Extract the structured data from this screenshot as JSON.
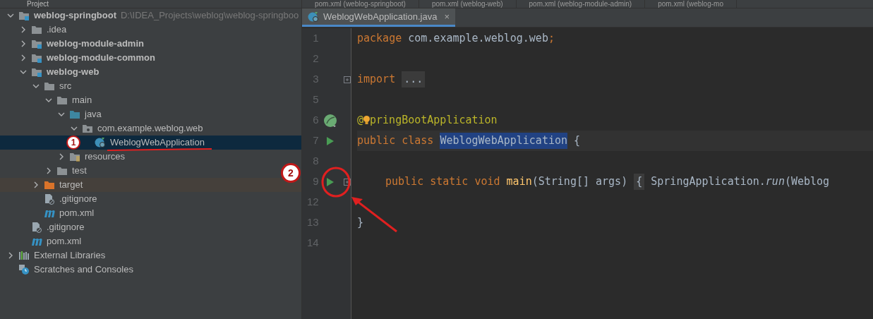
{
  "project_panel": {
    "title": "Project",
    "tree": [
      {
        "label": "weblog-springboot",
        "path": "D:\\IDEA_Projects\\weblog\\weblog-springboo",
        "kind": "module",
        "expanded": true,
        "selected": false,
        "children": [
          {
            "label": ".idea",
            "kind": "folder",
            "expanded": false,
            "selected": false
          },
          {
            "label": "weblog-module-admin",
            "kind": "module",
            "expanded": false,
            "selected": false
          },
          {
            "label": "weblog-module-common",
            "kind": "module",
            "expanded": false,
            "selected": false
          },
          {
            "label": "weblog-web",
            "kind": "module",
            "expanded": true,
            "selected": false,
            "children": [
              {
                "label": "src",
                "kind": "folder",
                "expanded": true,
                "selected": false,
                "children": [
                  {
                    "label": "main",
                    "kind": "folder",
                    "expanded": true,
                    "selected": false,
                    "children": [
                      {
                        "label": "java",
                        "kind": "source",
                        "expanded": true,
                        "selected": false,
                        "children": [
                          {
                            "label": "com.example.weblog.web",
                            "kind": "package",
                            "expanded": true,
                            "selected": false,
                            "children": [
                              {
                                "label": "WeblogWebApplication",
                                "kind": "class",
                                "selected": true
                              }
                            ]
                          }
                        ]
                      },
                      {
                        "label": "resources",
                        "kind": "resources",
                        "expanded": false,
                        "selected": false
                      }
                    ]
                  },
                  {
                    "label": "test",
                    "kind": "folder",
                    "expanded": false,
                    "selected": false
                  }
                ]
              },
              {
                "label": "target",
                "kind": "excluded",
                "expanded": false,
                "selected": false
              },
              {
                "label": ".gitignore",
                "kind": "ignore",
                "selected": false
              },
              {
                "label": "pom.xml",
                "kind": "maven",
                "selected": false
              }
            ]
          },
          {
            "label": ".gitignore",
            "kind": "ignore",
            "selected": false
          },
          {
            "label": "pom.xml",
            "kind": "maven",
            "selected": false
          }
        ]
      },
      {
        "label": "External Libraries",
        "kind": "libraries",
        "expanded": false,
        "selected": false
      },
      {
        "label": "Scratches and Consoles",
        "kind": "scratches",
        "selected": false
      }
    ]
  },
  "editor": {
    "upper_tabs": [
      "pom.xml (weblog-springboot)",
      "pom.xml (weblog-web)",
      "pom.xml (weblog-module-admin)",
      "pom.xml (weblog-mo"
    ],
    "tabs": [
      {
        "label": "WeblogWebApplication.java",
        "close": "×",
        "selected": true
      }
    ],
    "lines": [
      {
        "number": "1",
        "kind": "plain",
        "tokens": [
          {
            "kind": "keyword",
            "text": "package "
          },
          {
            "kind": "plain",
            "text": "com.example.weblog.web"
          },
          {
            "kind": "keyword",
            "text": ";"
          }
        ]
      },
      {
        "number": "2",
        "kind": "plain"
      },
      {
        "number": "3",
        "kind": "plain",
        "fold": true,
        "tokens": [
          {
            "kind": "keyword",
            "text": "import "
          },
          {
            "kind": "folded",
            "text": "..."
          }
        ]
      },
      {
        "number": "5",
        "kind": "plain"
      },
      {
        "number": "6",
        "kind": "spring",
        "tokens": [
          {
            "kind": "annotation",
            "text": "@"
          },
          {
            "kind": "bulb"
          },
          {
            "kind": "annotation",
            "text": "pringBootApplication"
          }
        ]
      },
      {
        "number": "7",
        "kind": "run",
        "tokens": [
          {
            "kind": "keyword",
            "text": "public class "
          },
          {
            "kind": "highlight",
            "text": "WeblogWebApplication"
          },
          {
            "kind": "plain",
            "text": " {"
          }
        ]
      },
      {
        "number": "8",
        "kind": "plain"
      },
      {
        "number": "9",
        "kind": "run",
        "fold": true,
        "indent": true,
        "tokens": [
          {
            "kind": "keyword",
            "text": "public static void "
          },
          {
            "kind": "method",
            "text": "main"
          },
          {
            "kind": "plain",
            "text": "(String[] args) "
          },
          {
            "kind": "folded",
            "text": "{"
          },
          {
            "kind": "plain",
            "text": " SpringApplication."
          },
          {
            "kind": "italic",
            "text": "run"
          },
          {
            "kind": "plain",
            "text": "(Weblog"
          }
        ]
      },
      {
        "number": "12",
        "kind": "plain"
      },
      {
        "number": "13",
        "kind": "plain",
        "tokens": [
          {
            "kind": "plain",
            "text": "}"
          }
        ]
      },
      {
        "number": "14",
        "kind": "plain"
      }
    ]
  },
  "annotations": [
    {
      "label": "1"
    },
    {
      "label": "2"
    }
  ]
}
